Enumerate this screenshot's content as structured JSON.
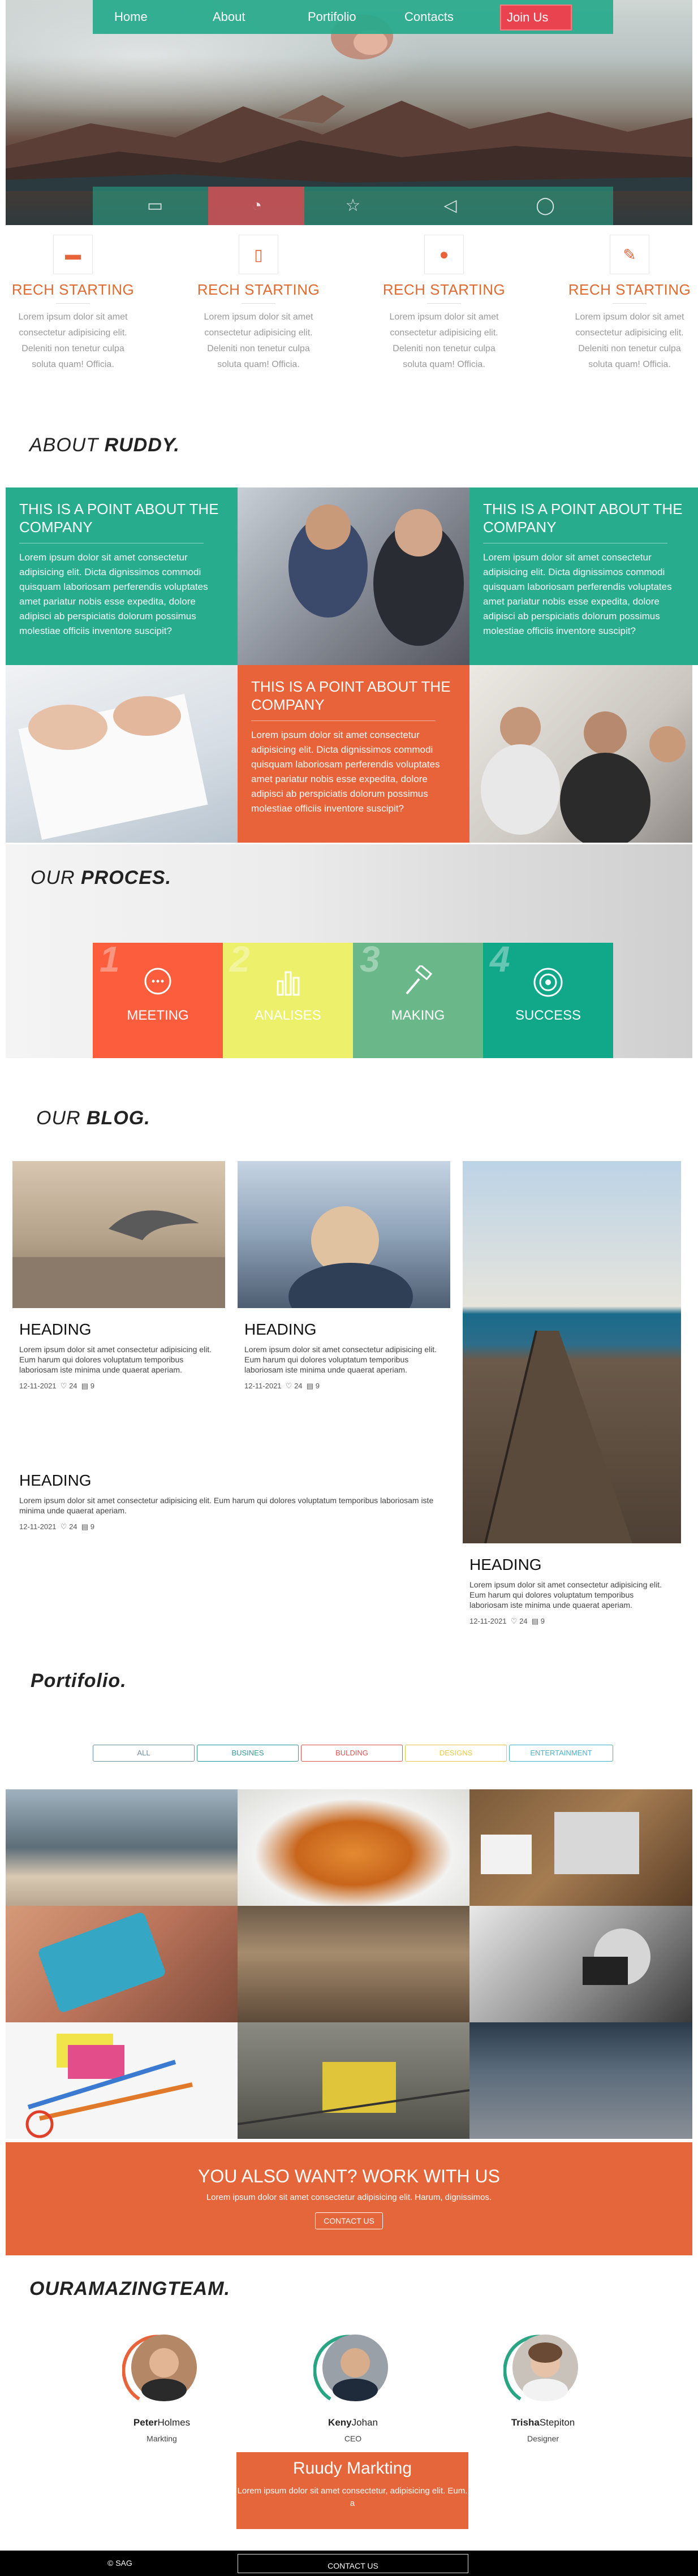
{
  "nav": {
    "home": "Home",
    "about": "About",
    "portfolio": "Portifolio",
    "contacts": "Contacts",
    "join": "Join Us"
  },
  "hero": {
    "icons": [
      "chart-icon",
      "speedometer-icon",
      "star-icon",
      "megaphone-icon",
      "bulb-icon"
    ]
  },
  "features": [
    {
      "title": "RECH STARTING",
      "text": "Lorem ipsum dolor sit amet consectetur adipisicing elit. Deleniti non tenetur culpa soluta quam! Officia.",
      "icon": "badge-icon"
    },
    {
      "title": "RECH STARTING",
      "text": "Lorem ipsum dolor sit amet consectetur adipisicing elit. Deleniti non tenetur culpa soluta quam! Officia.",
      "icon": "mobile-icon"
    },
    {
      "title": "RECH STARTING",
      "text": "Lorem ipsum dolor sit amet consectetur adipisicing elit. Deleniti non tenetur culpa soluta quam! Officia.",
      "icon": "piggy-bank-icon"
    },
    {
      "title": "RECH STARTING",
      "text": "Lorem ipsum dolor sit amet consectetur adipisicing elit. Deleniti non tenetur culpa soluta quam! Officia.",
      "icon": "paint-brush-icon"
    }
  ],
  "about": {
    "title_prefix": "ABOUT ",
    "title_bold": "RUDDY.",
    "points": [
      {
        "heading": "THIS IS A POINT ABOUT THE COMPANY",
        "text": "Lorem ipsum dolor sit amet consectetur adipisicing elit. Dicta dignissimos commodi quisquam laboriosam perferendis voluptates amet pariatur nobis esse expedita, dolore adipisci ab perspiciatis dolorum possimus molestiae officiis inventore suscipit?"
      },
      {
        "heading": "THIS IS A POINT ABOUT THE COMPANY",
        "text": "Lorem ipsum dolor sit amet consectetur adipisicing elit. Dicta dignissimos commodi quisquam laboriosam perferendis voluptates amet pariatur nobis esse expedita, dolore adipisci ab perspiciatis dolorum possimus molestiae officiis inventore suscipit?"
      },
      {
        "heading": "THIS IS A POINT ABOUT THE COMPANY",
        "text": "Lorem ipsum dolor sit amet consectetur adipisicing elit. Dicta dignissimos commodi quisquam laboriosam perferendis voluptates amet pariatur nobis esse expedita, dolore adipisci ab perspiciatis dolorum possimus molestiae officiis inventore suscipit?"
      }
    ]
  },
  "process": {
    "title_prefix": "OUR ",
    "title_bold": "PROCES.",
    "steps": [
      {
        "num": "1",
        "label": "MEETING",
        "color": "#fb5d3d",
        "icon": "chat-icon"
      },
      {
        "num": "2",
        "label": "ANALISES",
        "color": "#ecf06b",
        "icon": "bar-chart-icon"
      },
      {
        "num": "3",
        "label": "MAKING",
        "color": "#6ab889",
        "icon": "hammer-icon"
      },
      {
        "num": "4",
        "label": "SUCCESS",
        "color": "#11a88a",
        "icon": "target-icon"
      }
    ]
  },
  "blog": {
    "title_prefix": "OUR ",
    "title_bold": "BLOG.",
    "posts": [
      {
        "heading": "HEADING",
        "text": "Lorem ipsum dolor sit amet consectetur adipisicing elit. Eum harum qui dolores voluptatum temporibus laboriosam iste minima unde quaerat aperiam.",
        "date": "12-11-2021",
        "likes": "24",
        "comments": "9"
      },
      {
        "heading": "HEADING",
        "text": "Lorem ipsum dolor sit amet consectetur adipisicing elit. Eum harum qui dolores voluptatum temporibus laboriosam iste minima unde quaerat aperiam.",
        "date": "12-11-2021",
        "likes": "24",
        "comments": "9"
      },
      {
        "heading": "HEADING",
        "text": "Lorem ipsum dolor sit amet consectetur adipisicing elit. Eum harum qui dolores voluptatum temporibus laboriosam iste minima unde quaerat aperiam.",
        "date": "12-11-2021",
        "likes": "24",
        "comments": "9"
      },
      {
        "heading": "HEADING",
        "text": "Lorem ipsum dolor sit amet consectetur adipisicing elit. Eum harum qui dolores voluptatum temporibus laboriosam iste minima unde quaerat aperiam.",
        "date": "12-11-2021",
        "likes": "24",
        "comments": "9"
      }
    ]
  },
  "portfolio": {
    "title": "Portifolio.",
    "filters": [
      {
        "label": "ALL",
        "color": "#6f8fa3"
      },
      {
        "label": "BUSINES",
        "color": "#2f9a9a"
      },
      {
        "label": "BULDING",
        "color": "#d9534f"
      },
      {
        "label": "DESIGNS",
        "color": "#e8c84a"
      },
      {
        "label": "ENTERTAINMENT",
        "color": "#48b3c8"
      }
    ]
  },
  "cta": {
    "title": "YOU ALSO WANT? WORK WITH US",
    "text": "Lorem ipsum dolor sit amet consectetur adipisicing elit. Harum, dignissimos.",
    "button": "CONTACT US"
  },
  "team": {
    "title": "OURAMAZINGTEAM.",
    "members": [
      {
        "first": "Peter",
        "last": "Holmes",
        "role": "Markting",
        "ring": "#e8623a"
      },
      {
        "first": "Keny",
        "last": "Johan",
        "role": "CEO",
        "ring": "#2aa583"
      },
      {
        "first": "Trisha",
        "last": "Stepiton",
        "role": "Designer",
        "ring": "#2aa583"
      }
    ]
  },
  "banner": {
    "title": "Ruudy Markting",
    "text": "Lorem ipsum dolor sit amet consectetur, adipisicing elit. Eum. a"
  },
  "footer": {
    "copy": "© SAG",
    "button": "CONTACT US"
  }
}
